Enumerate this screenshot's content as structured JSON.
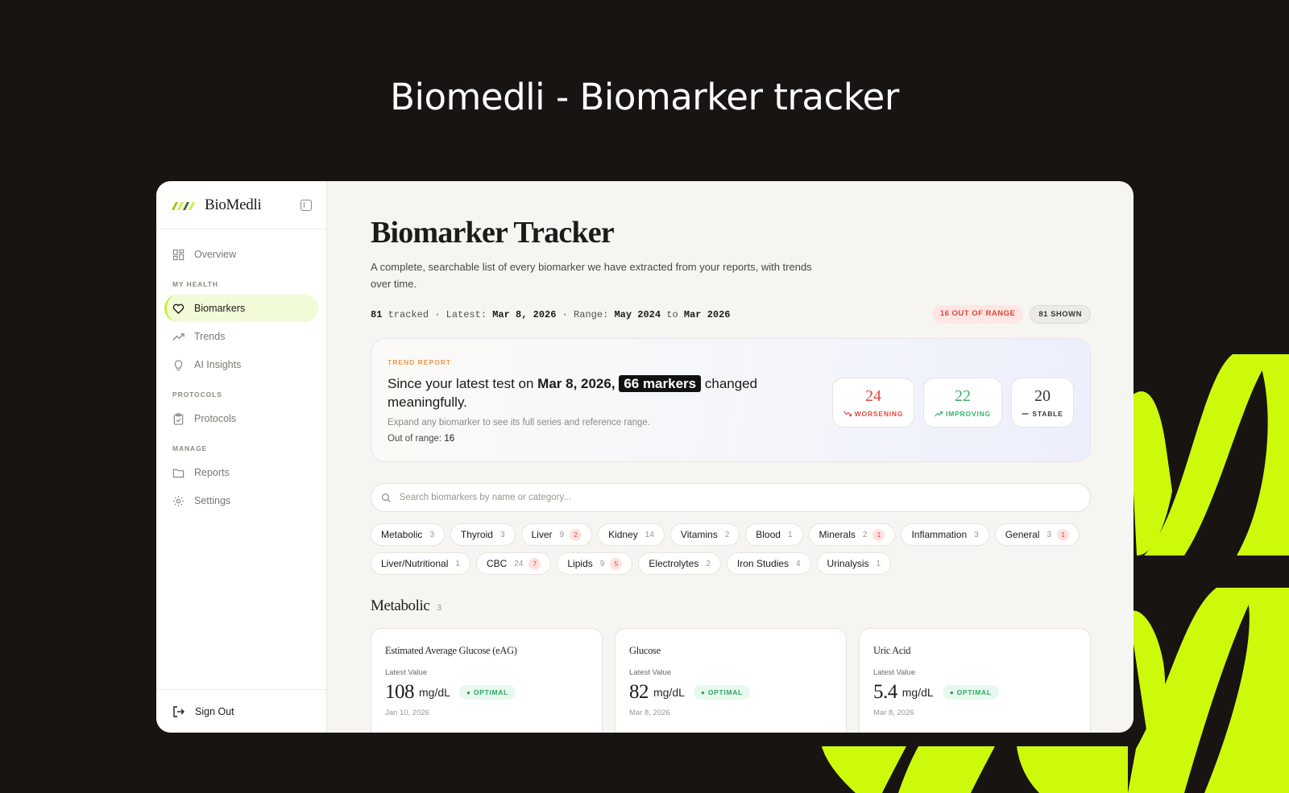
{
  "headline": "Biomedli - Biomarker tracker",
  "sidebar": {
    "brand": "BioMedli",
    "overview": "Overview",
    "section_health": "MY HEALTH",
    "biomarkers": "Biomarkers",
    "trends": "Trends",
    "ai_insights": "AI Insights",
    "section_protocols": "PROTOCOLS",
    "protocols": "Protocols",
    "section_manage": "MANAGE",
    "reports": "Reports",
    "settings": "Settings",
    "sign_out": "Sign Out"
  },
  "main": {
    "title": "Biomarker Tracker",
    "description": "A complete, searchable list of every biomarker we have extracted from your reports, with trends over time.",
    "meta": {
      "tracked_count": "81",
      "tracked_label": "tracked · Latest:",
      "latest": "Mar 8, 2026",
      "range_label": "· Range:",
      "range_start": "May 2024",
      "to_label": "to",
      "range_end": "Mar 2026"
    },
    "badge_out_of_range": "16 OUT OF RANGE",
    "badge_shown": "81 SHOWN"
  },
  "trend_report": {
    "label": "TREND REPORT",
    "text_prefix": "Since your latest test on",
    "date": "Mar 8, 2026,",
    "markers": "66 markers",
    "text_suffix": "changed meaningfully.",
    "sub": "Expand any biomarker to see its full series and reference range.",
    "out_of_range_label": "Out of range:",
    "out_of_range_value": "16",
    "worsening": {
      "count": "24",
      "label": "WORSENING"
    },
    "improving": {
      "count": "22",
      "label": "IMPROVING"
    },
    "stable": {
      "count": "20",
      "label": "STABLE"
    }
  },
  "search": {
    "placeholder": "Search biomarkers by name or category..."
  },
  "chips": [
    {
      "label": "Metabolic",
      "count": "3",
      "oor": ""
    },
    {
      "label": "Thyroid",
      "count": "3",
      "oor": ""
    },
    {
      "label": "Liver",
      "count": "9",
      "oor": "2"
    },
    {
      "label": "Kidney",
      "count": "14",
      "oor": ""
    },
    {
      "label": "Vitamins",
      "count": "2",
      "oor": ""
    },
    {
      "label": "Blood",
      "count": "1",
      "oor": ""
    },
    {
      "label": "Minerals",
      "count": "2",
      "oor": "1"
    },
    {
      "label": "Inflammation",
      "count": "3",
      "oor": ""
    },
    {
      "label": "General",
      "count": "3",
      "oor": "1"
    },
    {
      "label": "Liver/Nutritional",
      "count": "1",
      "oor": ""
    },
    {
      "label": "CBC",
      "count": "24",
      "oor": "7"
    },
    {
      "label": "Lipids",
      "count": "9",
      "oor": "5"
    },
    {
      "label": "Electrolytes",
      "count": "2",
      "oor": ""
    },
    {
      "label": "Iron Studies",
      "count": "4",
      "oor": ""
    },
    {
      "label": "Urinalysis",
      "count": "1",
      "oor": ""
    }
  ],
  "section": {
    "title": "Metabolic",
    "count": "3"
  },
  "cards": [
    {
      "name": "Estimated Average Glucose (eAG)",
      "latest_label": "Latest Value",
      "value": "108",
      "unit": "mg/dL",
      "status": "OPTIMAL",
      "date": "Jan 10, 2026"
    },
    {
      "name": "Glucose",
      "latest_label": "Latest Value",
      "value": "82",
      "unit": "mg/dL",
      "status": "OPTIMAL",
      "date": "Mar 8, 2026"
    },
    {
      "name": "Uric Acid",
      "latest_label": "Latest Value",
      "value": "5.4",
      "unit": "mg/dL",
      "status": "OPTIMAL",
      "date": "Mar 8, 2026"
    }
  ],
  "colors": {
    "accent": "#c7ef3a",
    "background": "#171412",
    "worsening": "#e0473c",
    "improving": "#34b36b"
  }
}
